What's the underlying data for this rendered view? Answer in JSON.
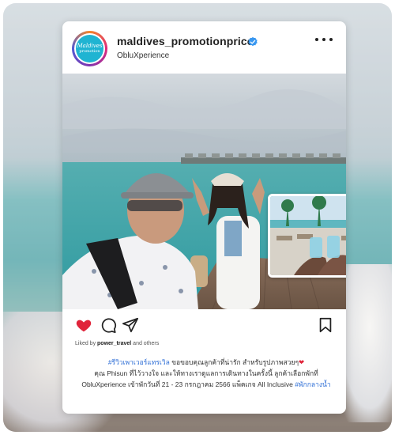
{
  "post": {
    "username": "maldives_promotionprice",
    "subtitle": "ObluXperience",
    "avatar_text_line1": "Maldives",
    "avatar_text_line2": "promotion",
    "verified": true,
    "liked_by_prefix": "Liked by",
    "liked_by_user": "power_travel",
    "liked_by_suffix": "and others",
    "caption_hashtag_1": "#รีวิวเพาเวอร์แทรเวิล",
    "caption_line_1": " ขอขอบคุณลูกค้าที่น่ารัก สำหรับรูปภาพสวยๆ",
    "caption_line_2": "คุณ Phisun ที่ไว้วางใจ และให้ทางเราดูแลการเดินทางในครั้งนี้ ลูกค้าเลือกพักที่ ObluXperience เข้าพักวันที่ 21 - 23 กรกฎาคม 2566 แพ็คเกจ All Inclusive ",
    "caption_hashtag_2": "#พักกลางน้ำ",
    "liked": true
  },
  "icons": {
    "like": "heart-icon",
    "comment": "comment-icon",
    "share": "share-icon",
    "save": "bookmark-icon",
    "more": "more-dots-icon",
    "verified": "verified-badge-icon"
  },
  "colors": {
    "like": "#e0243a",
    "verified": "#3897f0",
    "hashtag": "#2f6fd6",
    "avatar_bg": "#1fb4d2"
  }
}
